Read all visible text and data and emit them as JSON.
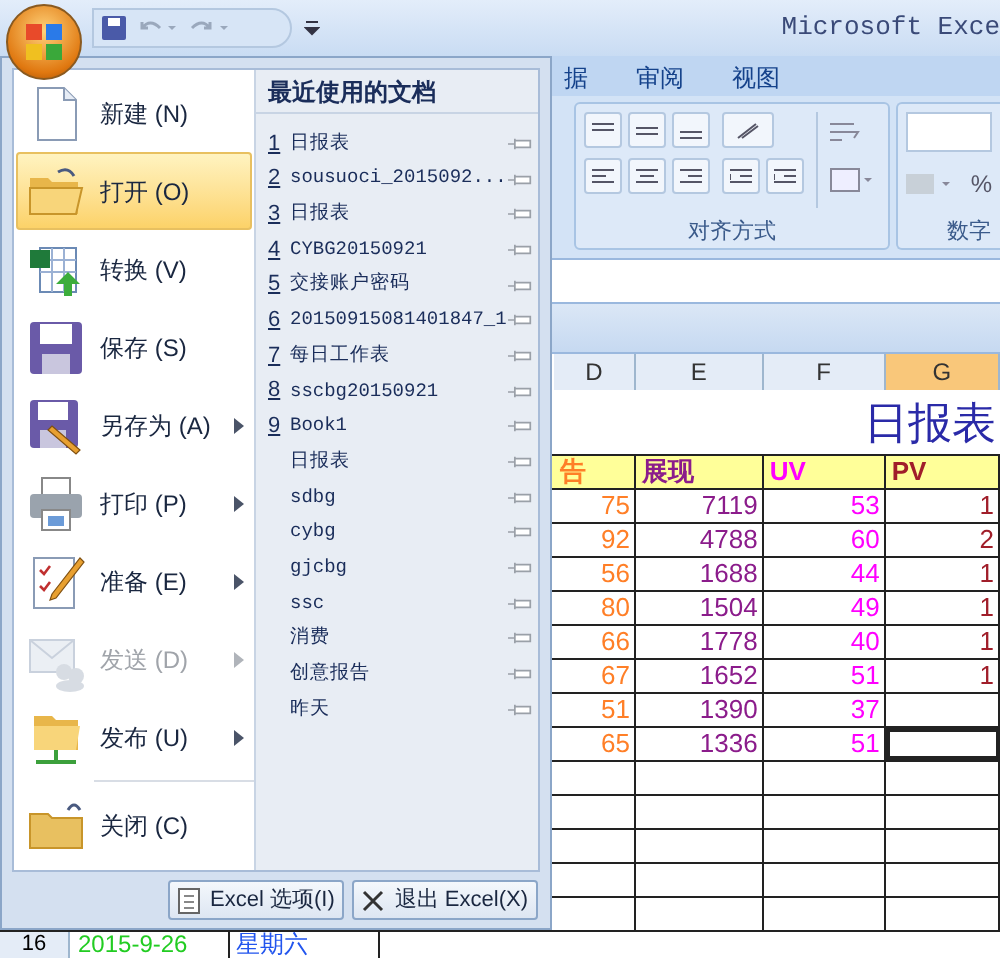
{
  "title_bar": {
    "title": "Microsoft Exce"
  },
  "ribbon": {
    "tabs": [
      {
        "label": "据"
      },
      {
        "label": "审阅"
      },
      {
        "label": "视图"
      }
    ],
    "groups": [
      {
        "label": "对齐方式",
        "kind": "alignment"
      },
      {
        "label": "数字",
        "kind": "number"
      }
    ],
    "percent": "%"
  },
  "sheet": {
    "columns": [
      {
        "letter": "D",
        "selected": false,
        "heading": "告",
        "color": "#ff7f27"
      },
      {
        "letter": "E",
        "selected": false,
        "heading": "展现",
        "color": "#8b1c8b"
      },
      {
        "letter": "F",
        "selected": false,
        "heading": "UV",
        "color": "#ff00ff"
      },
      {
        "letter": "G",
        "selected": true,
        "heading": "PV",
        "color": "#a01e2a"
      }
    ],
    "title": "日报表",
    "rows": [
      {
        "cells": [
          "75",
          "7119",
          "53",
          "1"
        ],
        "active": false
      },
      {
        "cells": [
          "92",
          "4788",
          "60",
          "2"
        ],
        "active": false
      },
      {
        "cells": [
          "56",
          "1688",
          "44",
          "1"
        ],
        "active": false
      },
      {
        "cells": [
          "80",
          "1504",
          "49",
          "1"
        ],
        "active": false
      },
      {
        "cells": [
          "66",
          "1778",
          "40",
          "1"
        ],
        "active": false
      },
      {
        "cells": [
          "67",
          "1652",
          "51",
          "1"
        ],
        "active": false
      },
      {
        "cells": [
          "51",
          "1390",
          "37"
        ],
        "active": false
      },
      {
        "cells": [
          "65",
          "1336",
          "51"
        ],
        "active": true
      }
    ],
    "last_row": {
      "number": "16",
      "date": "2015-9-26",
      "weekday": "星期六"
    }
  },
  "office_menu": {
    "commands": [
      {
        "label": "新建 (N)",
        "kind": "new",
        "selected": false,
        "submenu": false,
        "disabled": false
      },
      {
        "label": "打开 (O)",
        "kind": "open",
        "selected": true,
        "submenu": false,
        "disabled": false
      },
      {
        "label": "转换 (V)",
        "kind": "convert",
        "selected": false,
        "submenu": false,
        "disabled": false
      },
      {
        "label": "保存 (S)",
        "kind": "save",
        "selected": false,
        "submenu": false,
        "disabled": false
      },
      {
        "label": "另存为 (A)",
        "kind": "save_as",
        "selected": false,
        "submenu": true,
        "disabled": false
      },
      {
        "label": "打印 (P)",
        "kind": "print",
        "selected": false,
        "submenu": true,
        "disabled": false
      },
      {
        "label": "准备 (E)",
        "kind": "prepare",
        "selected": false,
        "submenu": true,
        "disabled": false
      },
      {
        "label": "发送 (D)",
        "kind": "send",
        "selected": false,
        "submenu": true,
        "disabled": true
      },
      {
        "label": "发布 (U)",
        "kind": "publish",
        "selected": false,
        "submenu": true,
        "disabled": false
      },
      {
        "label": "关闭 (C)",
        "kind": "close",
        "selected": false,
        "submenu": false,
        "disabled": false
      }
    ],
    "recent": {
      "heading": "最近使用的文档",
      "files": [
        {
          "number": "1",
          "name": "日报表"
        },
        {
          "number": "2",
          "name": "sousuoci_2015092..."
        },
        {
          "number": "3",
          "name": "日报表"
        },
        {
          "number": "4",
          "name": "CYBG20150921"
        },
        {
          "number": "5",
          "name": "交接账户密码"
        },
        {
          "number": "6",
          "name": "20150915081401847_1"
        },
        {
          "number": "7",
          "name": "每日工作表"
        },
        {
          "number": "8",
          "name": "sscbg20150921"
        },
        {
          "number": "9",
          "name": "Book1"
        },
        {
          "name": "日报表"
        },
        {
          "name": "sdbg"
        },
        {
          "name": "cybg"
        },
        {
          "name": "gjcbg"
        },
        {
          "name": "ssc"
        },
        {
          "name": "消费"
        },
        {
          "name": "创意报告"
        },
        {
          "name": "昨天"
        }
      ]
    },
    "footer_buttons": [
      {
        "label": "Excel 选项(I)",
        "kind": "options"
      },
      {
        "label": "退出 Excel(X)",
        "kind": "exit"
      }
    ]
  }
}
